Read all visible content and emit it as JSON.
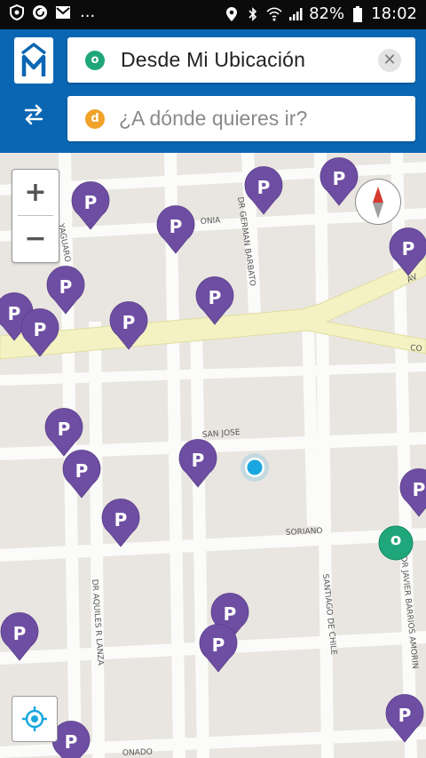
{
  "status_bar": {
    "battery": "82%",
    "time": "18:02",
    "dots": "..."
  },
  "app": {
    "logo_icon": "m-logo-icon",
    "origin_badge": "o",
    "destination_badge": "d",
    "from_value": "Desde Mi Ubicación",
    "to_placeholder": "¿A dónde quieres ir?",
    "clear_symbol": "✕"
  },
  "map": {
    "zoom_in": "+",
    "zoom_out": "−",
    "origin_marker": "o",
    "parking_letter": "P",
    "streets": [
      "YAGUARO",
      "DR GERMAN BARBATO",
      "ONIA",
      "AV",
      "CO",
      "SAN JOSE",
      "SORIANO",
      "DR AQUILES R LANZA",
      "SANTIAGO DE CHILE",
      "DR JAVIER BARRIOS AMORIN",
      "ONADO"
    ],
    "colors": {
      "parking": "#6d4ea2",
      "topbar": "#0a66b3",
      "origin_green": "#1fa67a",
      "destination_orange": "#f0a229",
      "user_dot": "#1aa7df"
    }
  }
}
